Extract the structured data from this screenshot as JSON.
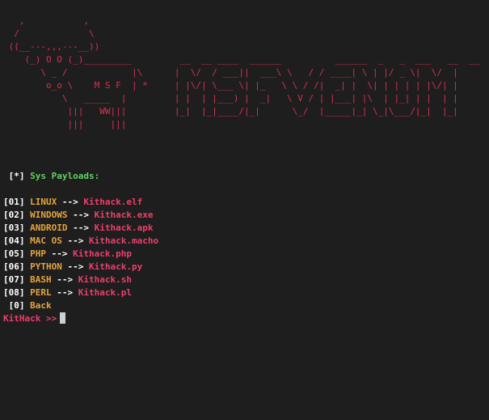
{
  "banner_art": [
    "   ,           ,",
    "  /             \\",
    " ((__---,,,---__))",
    "    (_) O O (_)_________         __  __ ____  ______          ______  _   _  ___   __  __",
    "       \\ _ /            |\\      |  \\/  / ___||  ___\\ \\   / / ____| \\ | |/ _ \\|  \\/  |",
    "        o_o \\    M S F  | *     | |\\/| \\___ \\| |_   \\ \\ / /|  _| |  \\| | | | | |\\/| |",
    "           \\   _____  |         | |  | |___) |  _|   \\ V / | |___| |\\  | |_| | |  | |",
    "            |||   WW|||         |_|  |_|____/|_|      \\_/  |_____|_| \\_|\\___/|_|  |_|",
    "            |||     |||"
  ],
  "section": {
    "marker": "[*]",
    "title": "Sys Payloads:"
  },
  "menu": [
    {
      "num": "[01]",
      "label": "LINUX",
      "arrow": "-->",
      "target": "Kithack.elf"
    },
    {
      "num": "[02]",
      "label": "WINDOWS",
      "arrow": "-->",
      "target": "Kithack.exe"
    },
    {
      "num": "[03]",
      "label": "ANDROID",
      "arrow": "-->",
      "target": "Kithack.apk"
    },
    {
      "num": "[04]",
      "label": "MAC OS",
      "arrow": "-->",
      "target": "Kithack.macho"
    },
    {
      "num": "[05]",
      "label": "PHP",
      "arrow": "-->",
      "target": "Kithack.php"
    },
    {
      "num": "[06]",
      "label": "PYTHON",
      "arrow": "-->",
      "target": "Kithack.py"
    },
    {
      "num": "[07]",
      "label": "BASH",
      "arrow": "-->",
      "target": "Kithack.sh"
    },
    {
      "num": "[08]",
      "label": "PERL",
      "arrow": "-->",
      "target": "Kithack.pl"
    },
    {
      "num": " [0]",
      "label": "Back",
      "arrow": "",
      "target": ""
    }
  ],
  "prompt": {
    "text": "KitHack >>"
  },
  "colors": {
    "background": "#1e1e1e",
    "banner": "#d9304f",
    "label": "#e8a33d",
    "target": "#ec3f6c",
    "section": "#5fd35f"
  }
}
